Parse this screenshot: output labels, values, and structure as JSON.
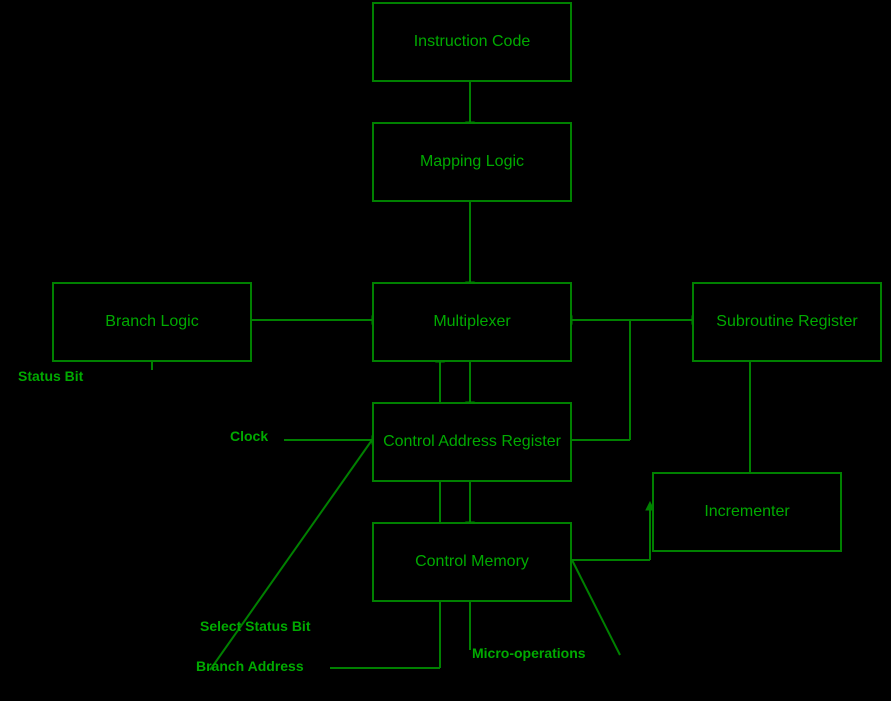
{
  "boxes": {
    "instruction_code": {
      "label": "Instruction Code"
    },
    "mapping_logic": {
      "label": "Mapping Logic"
    },
    "branch_logic": {
      "label": "Branch Logic"
    },
    "multiplexer": {
      "label": "Multiplexer"
    },
    "subroutine_register": {
      "label": "Subroutine Register"
    },
    "control_address_register": {
      "label": "Control Address\nRegister"
    },
    "incrementer": {
      "label": "Incrementer"
    },
    "control_memory": {
      "label": "Control Memory"
    }
  },
  "labels": {
    "status_bit": "Status Bit",
    "clock": "Clock",
    "select_status_bit": "Select Status Bit",
    "branch_address": "Branch Address",
    "micro_operations": "Micro-operations"
  },
  "colors": {
    "box_border": "#008000",
    "text": "#00aa00",
    "bg": "#000000"
  }
}
